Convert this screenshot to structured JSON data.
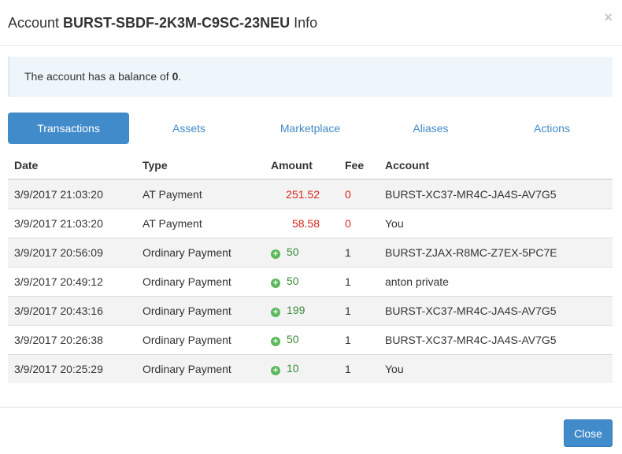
{
  "modal": {
    "title_prefix": "Account ",
    "title_account": "BURST-SBDF-2K3M-C9SC-23NEU",
    "title_suffix": " Info",
    "close_glyph": "×"
  },
  "alert": {
    "text_prefix": "The account has a balance of ",
    "balance": "0",
    "text_suffix": "."
  },
  "tabs": [
    "Transactions",
    "Assets",
    "Marketplace",
    "Aliases",
    "Actions"
  ],
  "table": {
    "headers": [
      "Date",
      "Type",
      "Amount",
      "Fee",
      "Account"
    ],
    "rows": [
      {
        "date": "3/9/2017 21:03:20",
        "type": "AT Payment",
        "amount": "251.52",
        "fee": "0",
        "account": "BURST-XC37-MR4C-JA4S-AV7G5"
      },
      {
        "date": "3/9/2017 21:03:20",
        "type": "AT Payment",
        "amount": "58.58",
        "fee": "0",
        "account": "You"
      },
      {
        "date": "3/9/2017 20:56:09",
        "type": "Ordinary Payment",
        "amount": "50",
        "fee": "1",
        "account": "BURST-ZJAX-R8MC-Z7EX-5PC7E"
      },
      {
        "date": "3/9/2017 20:49:12",
        "type": "Ordinary Payment",
        "amount": "50",
        "fee": "1",
        "account": "anton private"
      },
      {
        "date": "3/9/2017 20:43:16",
        "type": "Ordinary Payment",
        "amount": "199",
        "fee": "1",
        "account": "BURST-XC37-MR4C-JA4S-AV7G5"
      },
      {
        "date": "3/9/2017 20:26:38",
        "type": "Ordinary Payment",
        "amount": "50",
        "fee": "1",
        "account": "BURST-XC37-MR4C-JA4S-AV7G5"
      },
      {
        "date": "3/9/2017 20:25:29",
        "type": "Ordinary Payment",
        "amount": "10",
        "fee": "1",
        "account": "You"
      }
    ]
  },
  "footer": {
    "close_label": "Close"
  },
  "colors": {
    "accent": "#428bca",
    "negative": "#d9261c",
    "positive": "#3c8c3c",
    "plus_icon": "#5cb85c"
  },
  "icons": {
    "incoming": "plus-circle-icon",
    "close": "close-icon"
  }
}
